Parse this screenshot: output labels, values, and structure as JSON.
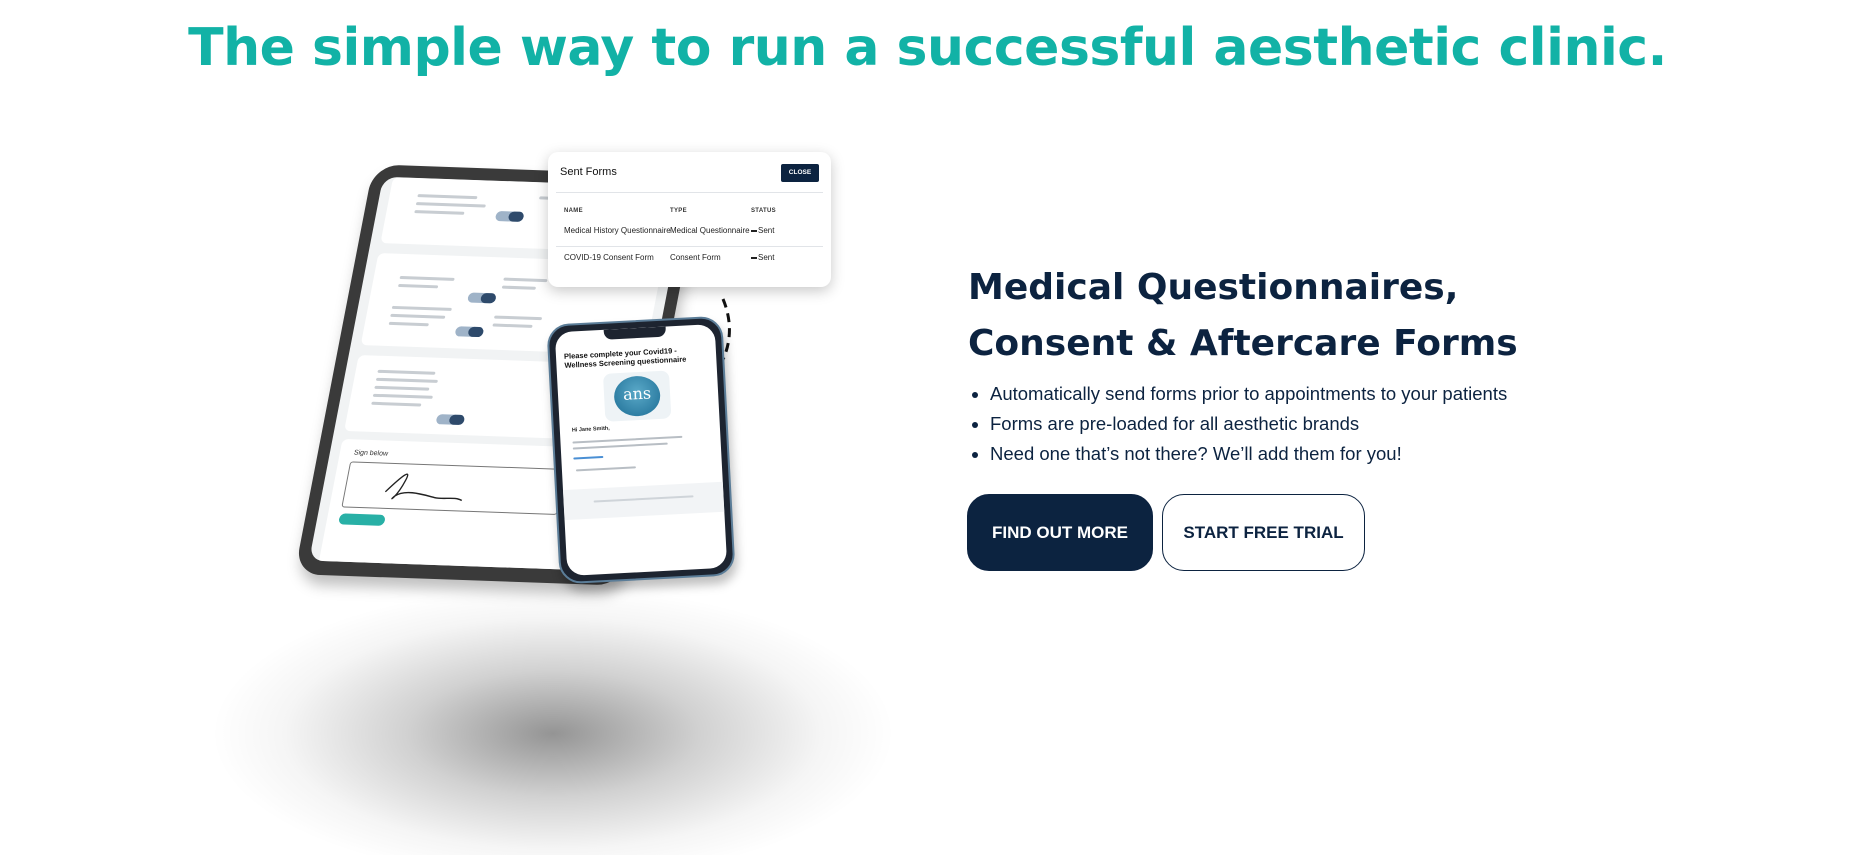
{
  "hero": {
    "title": "The simple way to run a successful aesthetic clinic.",
    "title_color": "#12b2a6"
  },
  "feature": {
    "title": "Medical Questionnaires, Consent & Aftercare Forms",
    "bullets": [
      "Automatically send forms prior to appointments to your patients",
      "Forms are pre-loaded for all aesthetic brands",
      "Need one that’s not there? We’ll add them for you!"
    ],
    "primary_button": "FIND OUT MORE",
    "secondary_button": "START FREE TRIAL",
    "text_color": "#0c2340"
  },
  "illustration": {
    "popup": {
      "title": "Sent Forms",
      "close_label": "CLOSE",
      "columns": [
        "NAME",
        "TYPE",
        "STATUS"
      ],
      "rows": [
        {
          "name": "Medical History Questionnaire",
          "type": "Medical Questionnaire",
          "status": "Sent"
        },
        {
          "name": "COVID-19 Consent Form",
          "type": "Consent Form",
          "status": "Sent"
        }
      ]
    },
    "tablet": {
      "sign_label": "Sign below"
    },
    "phone": {
      "heading": "Please complete your Covid19 - Wellness Screening questionnaire",
      "logo_text": "ans",
      "greeting": "Hi Jane Smith,"
    },
    "accent_color": "#28b0a6"
  }
}
